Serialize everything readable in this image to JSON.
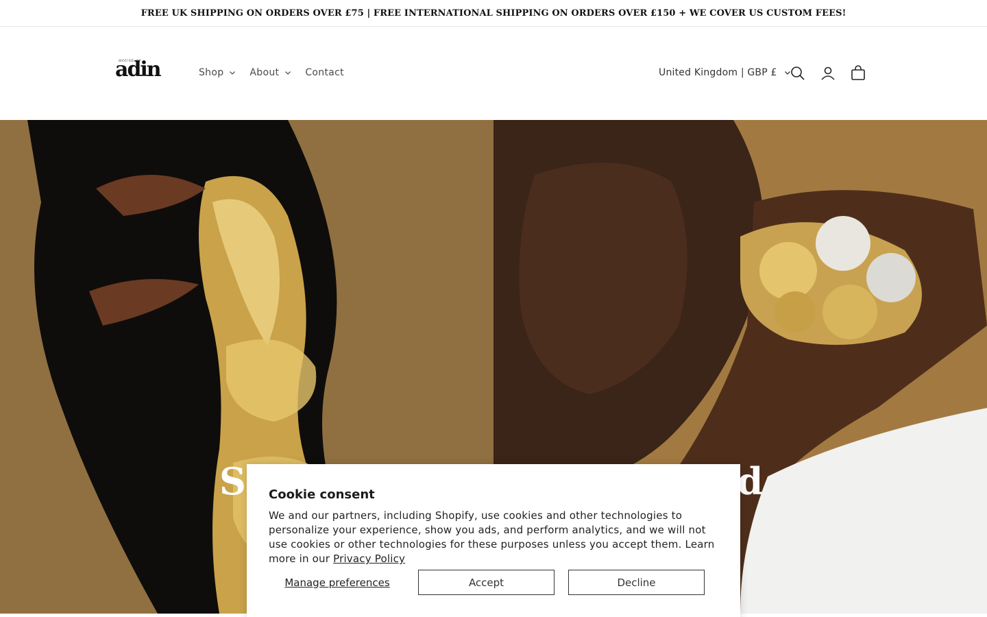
{
  "announcement": {
    "text": "FREE UK SHIPPING ON ORDERS OVER £75 | FREE INTERNATIONAL SHIPPING ON ORDERS OVER £150 + WE COVER US CUSTOM FEES!"
  },
  "header": {
    "logo_small": "HOUSE OF",
    "logo_big": "adin",
    "nav": [
      {
        "label": "Shop"
      },
      {
        "label": "About"
      },
      {
        "label": "Contact"
      }
    ],
    "country_selector": "United Kingdom | GBP £",
    "icons": [
      "search-icon",
      "account-icon",
      "cart-icon"
    ]
  },
  "hero": {
    "heading_left_fragment": "St",
    "heading_right_fragment": "ld"
  },
  "cookie": {
    "title": "Cookie consent",
    "body": "We and our partners, including Shopify, use cookies and other technologies to personalize your experience, show you ads, and perform analytics, and we will not use cookies or other technologies for these purposes unless you accept them. Learn more in our ",
    "link": "Privacy Policy",
    "manage_label": "Manage preferences",
    "accept_label": "Accept",
    "decline_label": "Decline"
  }
}
